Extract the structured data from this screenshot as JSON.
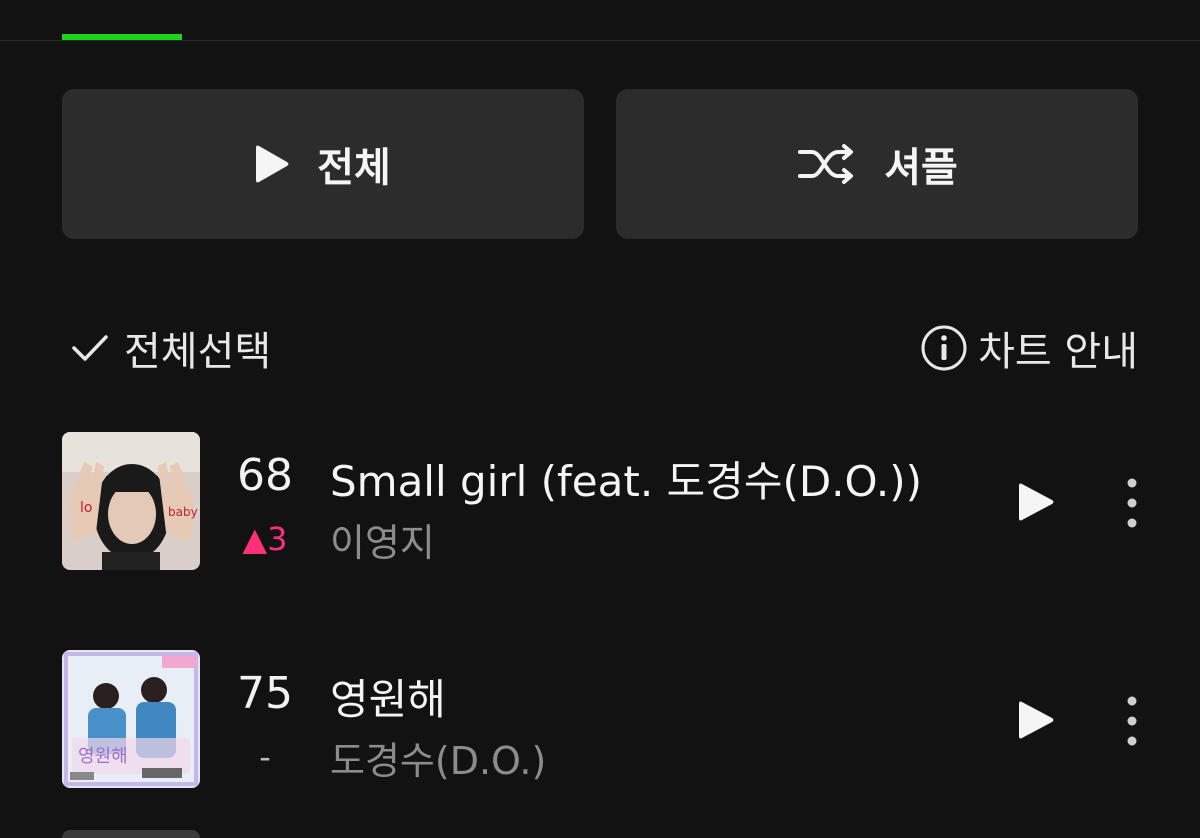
{
  "actions": {
    "play_all_label": "전체",
    "shuffle_label": "셔플"
  },
  "controls": {
    "select_all_label": "전체선택",
    "chart_guide_label": "차트 안내"
  },
  "accent_color": "#1ed31e",
  "rank_up_color": "#ff2f7a",
  "tracks": [
    {
      "rank": "68",
      "change": "▲3",
      "change_type": "up",
      "title": "Small girl (feat. 도경수(D.O.))",
      "artist": "이영지"
    },
    {
      "rank": "75",
      "change": "-",
      "change_type": "same",
      "title": "영원해",
      "artist": "도경수(D.O.)"
    }
  ]
}
